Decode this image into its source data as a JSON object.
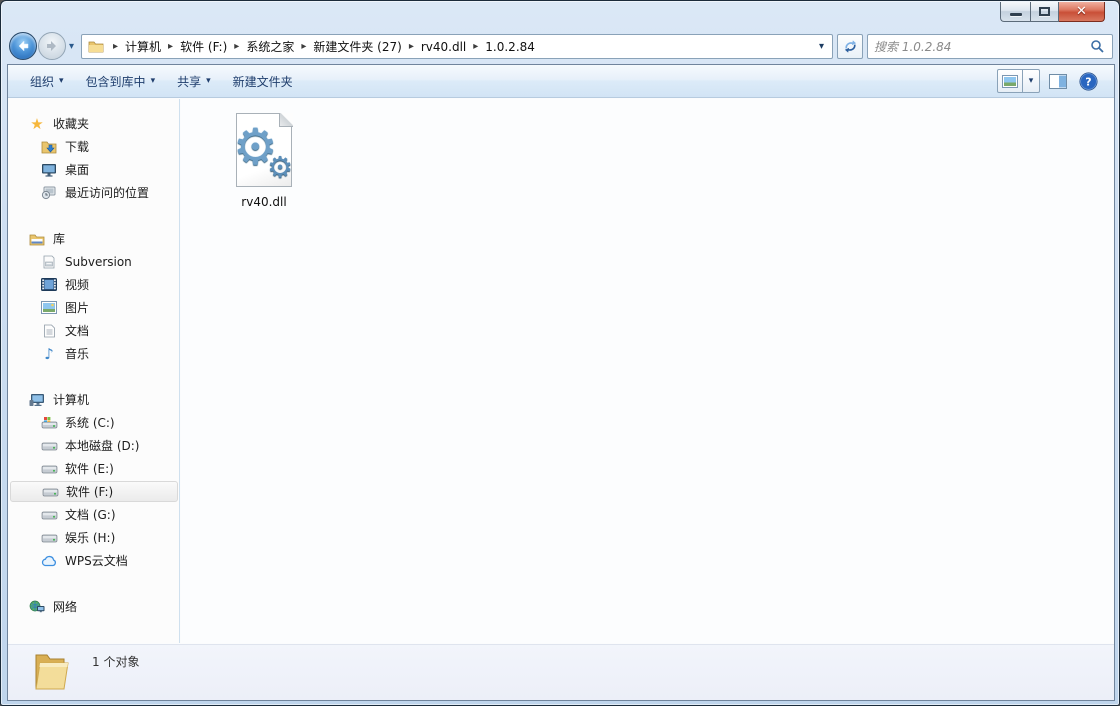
{
  "navigation": {
    "breadcrumb": [
      "计算机",
      "软件 (F:)",
      "系统之家",
      "新建文件夹 (27)",
      "rv40.dll",
      "1.0.2.84"
    ],
    "search_placeholder": "搜索 1.0.2.84"
  },
  "toolbar": {
    "organize": "组织",
    "include_in_library": "包含到库中",
    "share": "共享",
    "new_folder": "新建文件夹"
  },
  "sidebar": {
    "favorites": {
      "label": "收藏夹",
      "items": [
        "下载",
        "桌面",
        "最近访问的位置"
      ]
    },
    "libraries": {
      "label": "库",
      "items": [
        "Subversion",
        "视频",
        "图片",
        "文档",
        "音乐"
      ]
    },
    "computer": {
      "label": "计算机",
      "items": [
        "系统 (C:)",
        "本地磁盘 (D:)",
        "软件 (E:)",
        "软件 (F:)",
        "文档 (G:)",
        "娱乐 (H:)",
        "WPS云文档"
      ],
      "selected_item": "软件 (F:)"
    },
    "network": {
      "label": "网络"
    }
  },
  "files": [
    {
      "name": "rv40.dll"
    }
  ],
  "statusbar": {
    "text": "1 个对象"
  },
  "glyphs": {
    "gear": "⚙",
    "music_note": "♪",
    "star": "★",
    "help": "?",
    "close": "✕",
    "breadcrumb_sep": "▸",
    "dropdown": "▾"
  },
  "colors": {
    "glass": "#cfdff2",
    "toolbar_text": "#1f3e6d",
    "close_red": "#c94f37",
    "selection_gray": "#ebebeb"
  }
}
